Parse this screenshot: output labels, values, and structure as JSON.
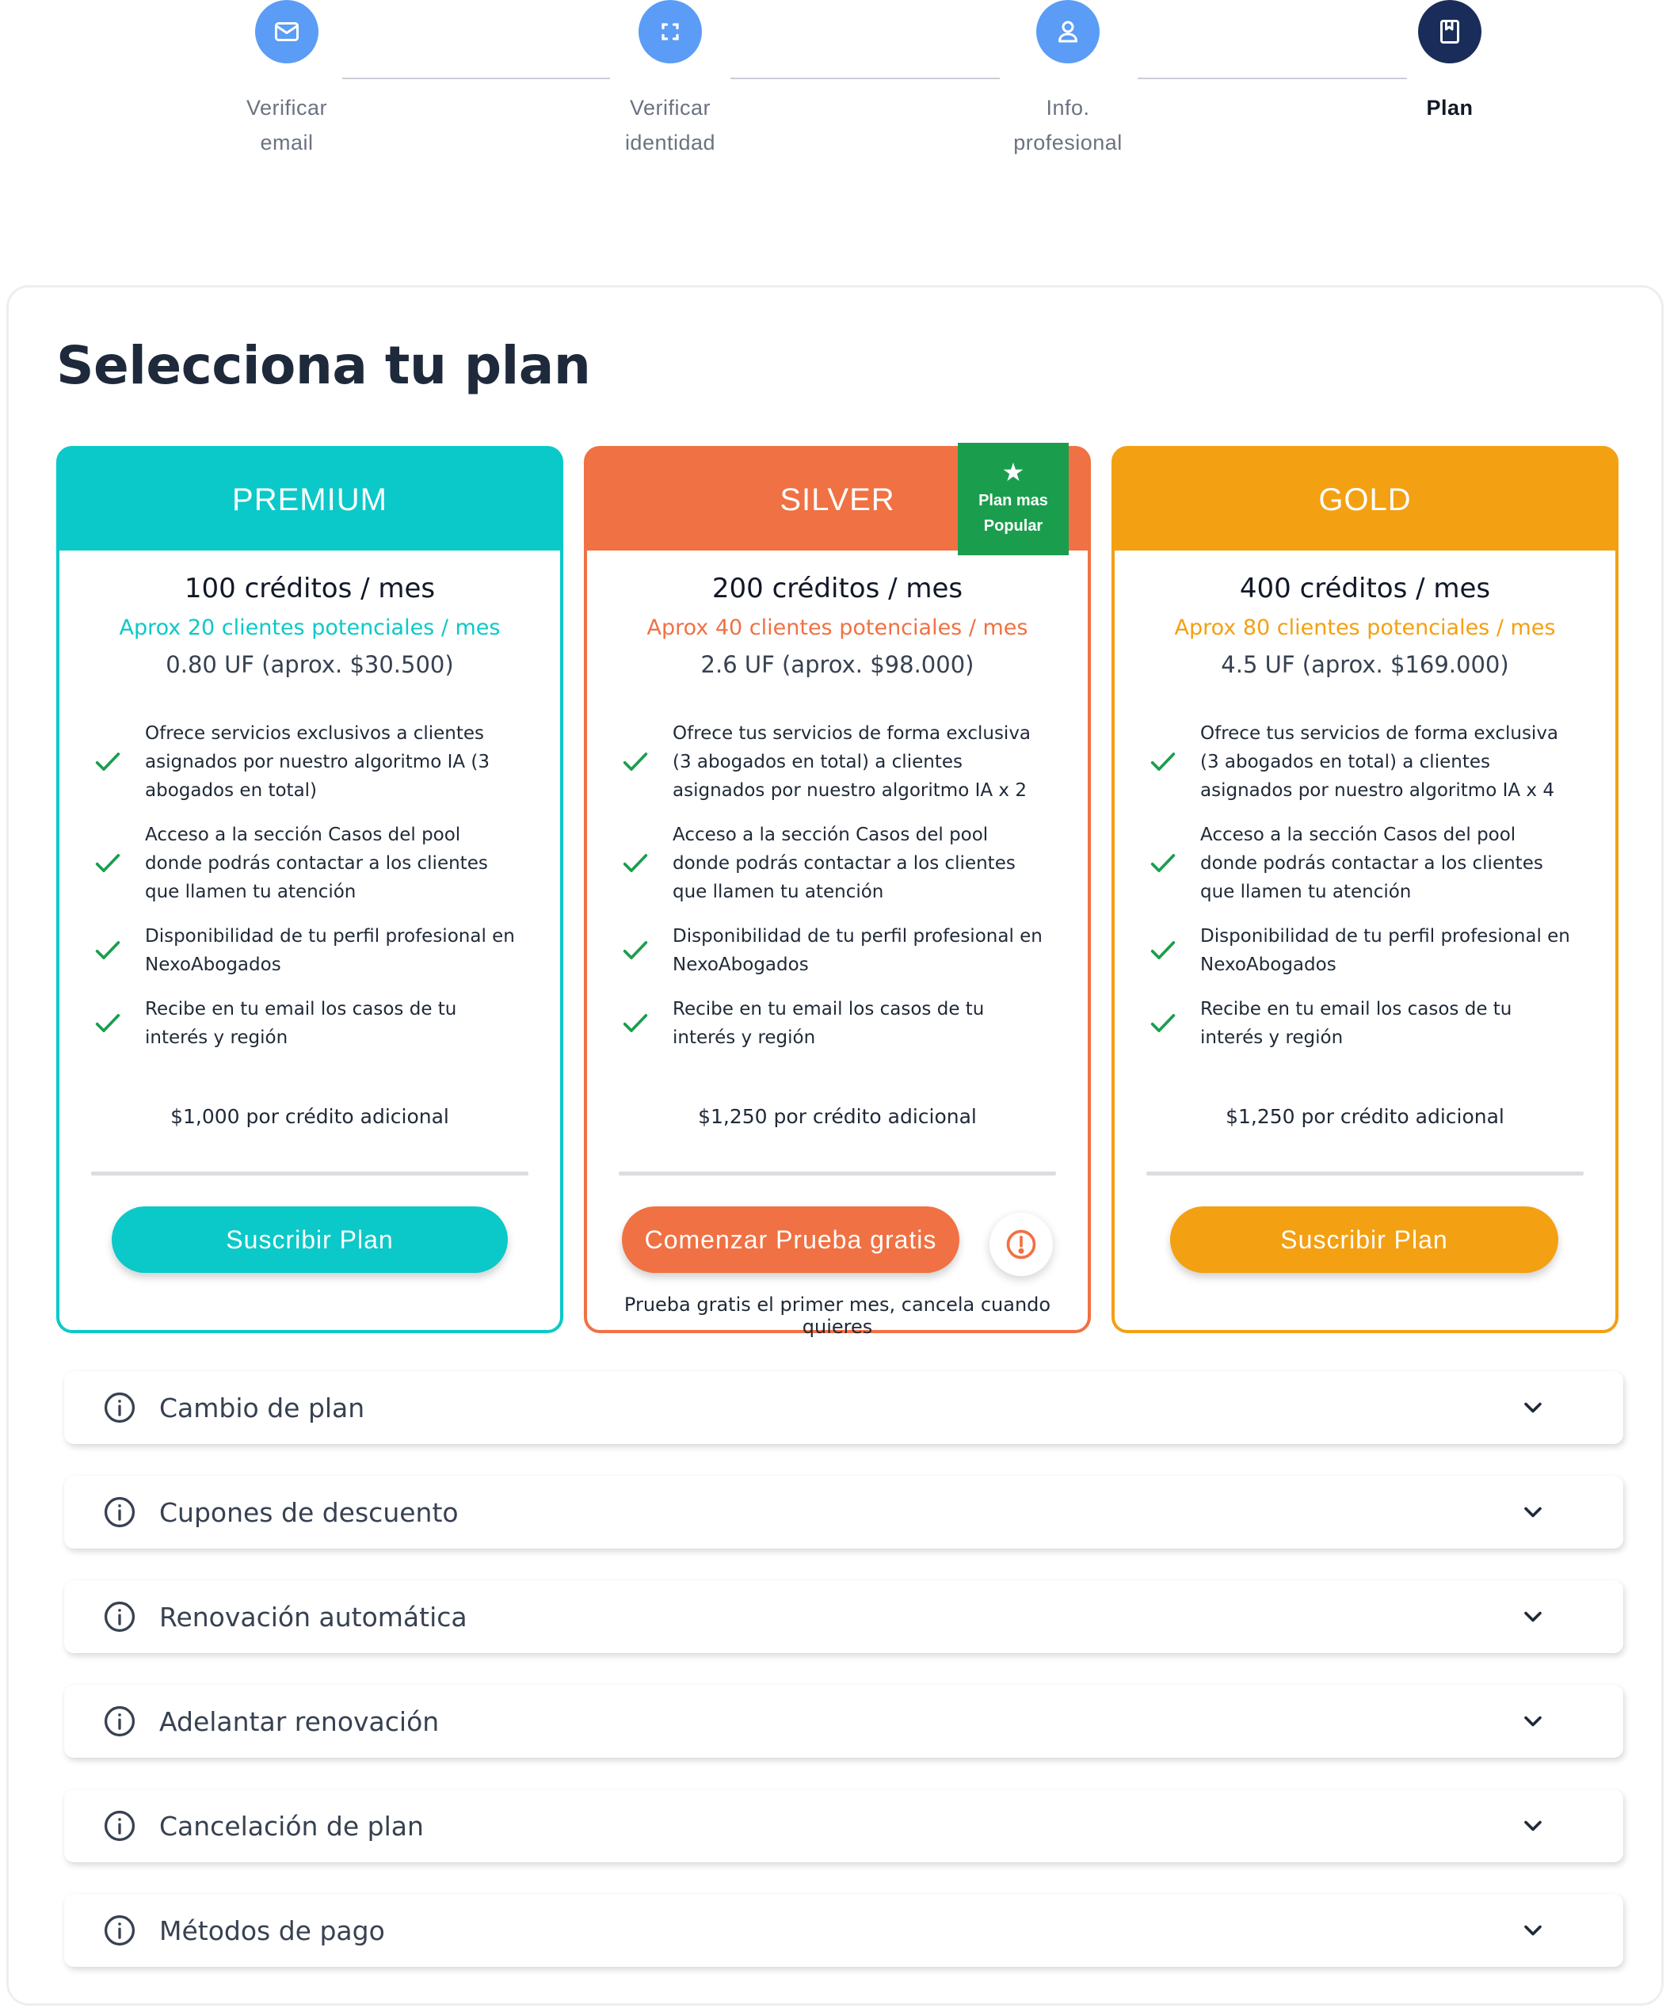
{
  "stepper": {
    "steps": [
      {
        "line1": "Verificar",
        "line2": "email",
        "icon": "mail-icon",
        "color": "#5b9cf6",
        "active": false
      },
      {
        "line1": "Verificar",
        "line2": "identidad",
        "icon": "scan-icon",
        "color": "#5b9cf6",
        "active": false
      },
      {
        "line1": "Info.",
        "line2": "profesional",
        "icon": "user-icon",
        "color": "#5b9cf6",
        "active": false
      },
      {
        "line1": "Plan",
        "line2": "",
        "icon": "bookmark-icon",
        "color": "#1a2d5a",
        "active": true
      }
    ]
  },
  "page_title": "Selecciona tu plan",
  "plans": [
    {
      "name": "PREMIUM",
      "accent": "#0bc9c8",
      "credits": "100 créditos / mes",
      "clients": "Aprox 20 clientes potenciales / mes",
      "price": "0.80 UF (aprox. $30.500)",
      "features": [
        "Ofrece servicios exclusivos a clientes asignados por nuestro algoritmo IA (3 abogados en total)",
        "Acceso a la sección Casos del pool donde podrás contactar a los clientes que llamen tu atención",
        "Disponibilidad de tu perfil profesional en NexoAbogados",
        "Recibe en tu email los casos de tu interés y región"
      ],
      "extra_credit": "$1,000 por crédito adicional",
      "cta": "Suscribir Plan"
    },
    {
      "name": "SILVER",
      "accent": "#f07143",
      "badge": "Plan mas Popular",
      "badge_color": "#1a9e4e",
      "credits": "200 créditos / mes",
      "clients": "Aprox 40 clientes potenciales / mes",
      "price": "2.6 UF (aprox. $98.000)",
      "features": [
        "Ofrece tus servicios de forma exclusiva (3 abogados en total) a clientes asignados por nuestro algoritmo IA x 2",
        "Acceso a la sección Casos del pool donde podrás contactar a los clientes que llamen tu atención",
        "Disponibilidad de tu perfil profesional en NexoAbogados",
        "Recibe en tu email los casos de tu interés y región"
      ],
      "extra_credit": "$1,250 por crédito adicional",
      "cta": "Comenzar Prueba gratis",
      "trial_note": "Prueba gratis el primer mes, cancela cuando quieres"
    },
    {
      "name": "GOLD",
      "accent": "#f3a012",
      "credits": "400 créditos / mes",
      "clients": "Aprox 80 clientes potenciales / mes",
      "price": "4.5 UF (aprox. $169.000)",
      "features": [
        "Ofrece tus servicios de forma exclusiva (3 abogados en total) a clientes asignados por nuestro algoritmo IA x 4",
        "Acceso a la sección Casos del pool donde podrás contactar a los clientes que llamen tu atención",
        "Disponibilidad de tu perfil profesional en NexoAbogados",
        "Recibe en tu email los casos de tu interés y región"
      ],
      "extra_credit": "$1,250 por crédito adicional",
      "cta": "Suscribir Plan"
    }
  ],
  "check_color": "#1a9e4e",
  "accordion": [
    "Cambio de plan",
    "Cupones de descuento",
    "Renovación automática",
    "Adelantar renovación",
    "Cancelación de plan",
    "Métodos de pago"
  ]
}
